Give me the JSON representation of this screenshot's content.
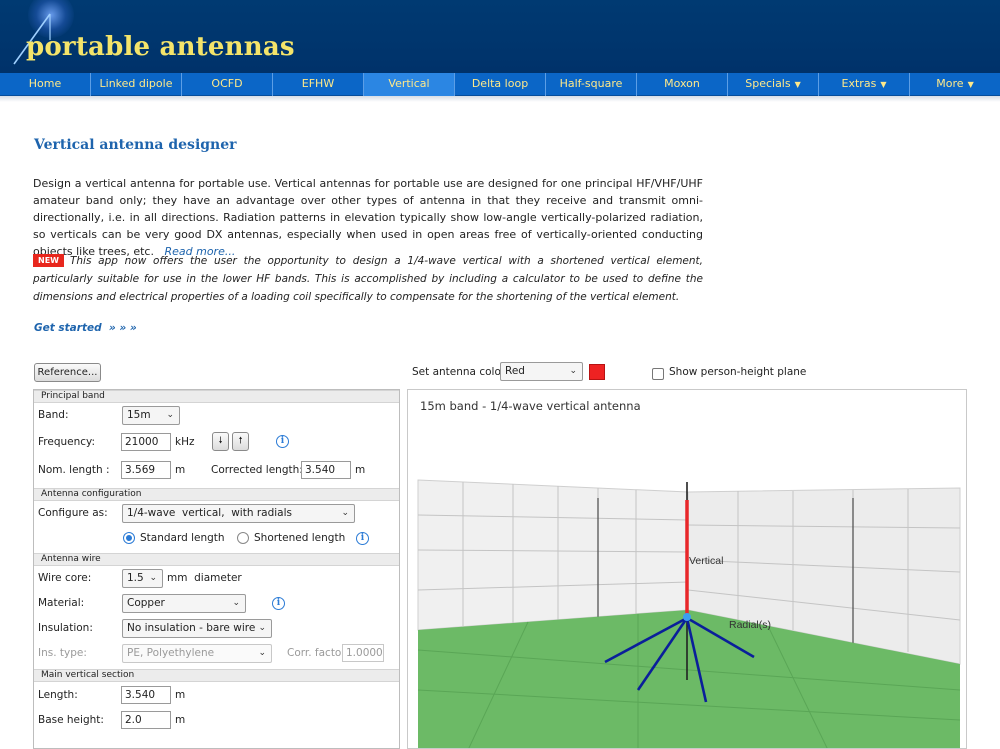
{
  "site": {
    "logo_text": "portable antennas"
  },
  "nav": {
    "items": [
      {
        "label": "Home"
      },
      {
        "label": "Linked dipole"
      },
      {
        "label": "OCFD"
      },
      {
        "label": "EFHW"
      },
      {
        "label": "Vertical"
      },
      {
        "label": "Delta loop"
      },
      {
        "label": "Half-square"
      },
      {
        "label": "Moxon"
      },
      {
        "label": "Specials"
      },
      {
        "label": "Extras"
      },
      {
        "label": "More"
      }
    ],
    "caret": "▼"
  },
  "page": {
    "title": "Vertical antenna designer",
    "intro": "Design a vertical antenna for portable use. Vertical antennas for portable use are designed for one principal HF/VHF/UHF amateur band only; they have an advantage over other types of antenna in that they receive and transmit omni-directionally, i.e. in all directions. Radiation patterns in elevation typically show low-angle vertically-polarized radiation, so verticals can be very good DX antennas, especially when used in open areas free of vertically-oriented conducting objects like trees, etc.",
    "read_more": "Read more...",
    "new_badge": "NEW",
    "new_text": "This app now offers the user the opportunity to design a 1/4-wave vertical with a shortened vertical element, particularly suitable for use in the lower HF bands. This is accomplished by including a calculator to be used to define the dimensions and electrical properties of a loading coil specifically to compensate for the shortening of the vertical element.",
    "get_started": "Get started",
    "get_started_arrows": "» » »"
  },
  "controls": {
    "reference_button": "Reference...",
    "color_label": "Set antenna color:",
    "color_value": "Red",
    "color_swatch": "#ee2222",
    "person_plane_label": "Show person-height plane",
    "select_arrow": "⌄"
  },
  "panel": {
    "principal_band": {
      "heading": "Principal band",
      "band_label": "Band:",
      "band_value": "15m",
      "frequency_label": "Frequency:",
      "frequency_value": "21000",
      "frequency_unit": "kHz",
      "step_down": "🠗",
      "step_up": "🠕",
      "nom_length_label": "Nom. length :",
      "nom_length_value": "3.569",
      "nom_length_unit": "m",
      "corrected_label": "Corrected length:",
      "corrected_value": "3.540",
      "corrected_unit": "m"
    },
    "configuration": {
      "heading": "Antenna configuration",
      "configure_label": "Configure as:",
      "configure_value": "1/4-wave  vertical,  with radials",
      "standard_label": "Standard length",
      "shortened_label": "Shortened length"
    },
    "wire": {
      "heading": "Antenna wire",
      "core_label": "Wire core:",
      "core_value": "1.5",
      "core_unit": "mm  diameter",
      "material_label": "Material:",
      "material_value": "Copper",
      "insulation_label": "Insulation:",
      "insulation_value": "No insulation - bare wire",
      "ins_type_label": "Ins. type:",
      "ins_type_value": "PE, Polyethylene",
      "corr_factor_label": "Corr. factor:",
      "corr_factor_value": "1.0000"
    },
    "main_vertical": {
      "heading": "Main vertical section",
      "length_label": "Length:",
      "length_value": "3.540",
      "length_unit": "m",
      "base_label": "Base height:",
      "base_value": "2.0",
      "base_unit": "m"
    },
    "info_glyph": "i"
  },
  "view": {
    "title": "15m band - 1/4-wave vertical antenna",
    "vertical_label": "Vertical",
    "radials_label": "Radial(s)",
    "colors": {
      "antenna": "#e8272a",
      "radials": "#0a1f9a",
      "ground": "#6cba66",
      "walls": "#efefef"
    }
  }
}
